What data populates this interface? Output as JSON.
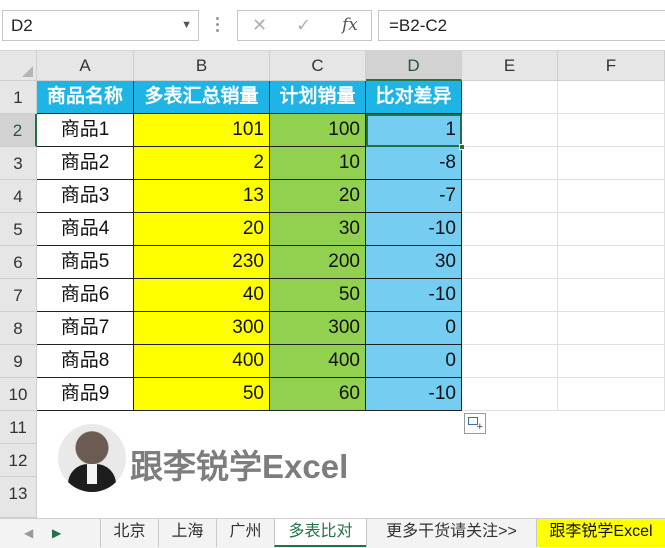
{
  "formula_bar": {
    "name_box": "D2",
    "cancel_glyph": "✕",
    "enter_glyph": "✓",
    "fx_label": "fx",
    "formula": "=B2-C2"
  },
  "columns": [
    "A",
    "B",
    "C",
    "D",
    "E",
    "F"
  ],
  "rows": [
    "1",
    "2",
    "3",
    "4",
    "5",
    "6",
    "7",
    "8",
    "9",
    "10",
    "11",
    "12",
    "13"
  ],
  "table": {
    "headers": [
      "商品名称",
      "多表汇总销量",
      "计划销量",
      "比对差异"
    ],
    "rows": [
      {
        "name": "商品1",
        "summary": "101",
        "plan": "100",
        "diff": "1"
      },
      {
        "name": "商品2",
        "summary": "2",
        "plan": "10",
        "diff": "-8"
      },
      {
        "name": "商品3",
        "summary": "13",
        "plan": "20",
        "diff": "-7"
      },
      {
        "name": "商品4",
        "summary": "20",
        "plan": "30",
        "diff": "-10"
      },
      {
        "name": "商品5",
        "summary": "230",
        "plan": "200",
        "diff": "30"
      },
      {
        "name": "商品6",
        "summary": "40",
        "plan": "50",
        "diff": "-10"
      },
      {
        "name": "商品7",
        "summary": "300",
        "plan": "300",
        "diff": "0"
      },
      {
        "name": "商品8",
        "summary": "400",
        "plan": "400",
        "diff": "0"
      },
      {
        "name": "商品9",
        "summary": "50",
        "plan": "60",
        "diff": "-10"
      }
    ]
  },
  "watermark": {
    "text": "跟李锐学Excel"
  },
  "sheet_tabs": [
    "北京",
    "上海",
    "广州",
    "多表比对",
    "更多干货请关注>>",
    "跟李锐学Excel"
  ],
  "active_tab": "多表比对",
  "colors": {
    "header_fill": "#1fb4e6",
    "col_b_fill": "#ffff00",
    "col_c_fill": "#92d050",
    "col_d_fill": "#76cdf2",
    "excel_green": "#217346"
  }
}
